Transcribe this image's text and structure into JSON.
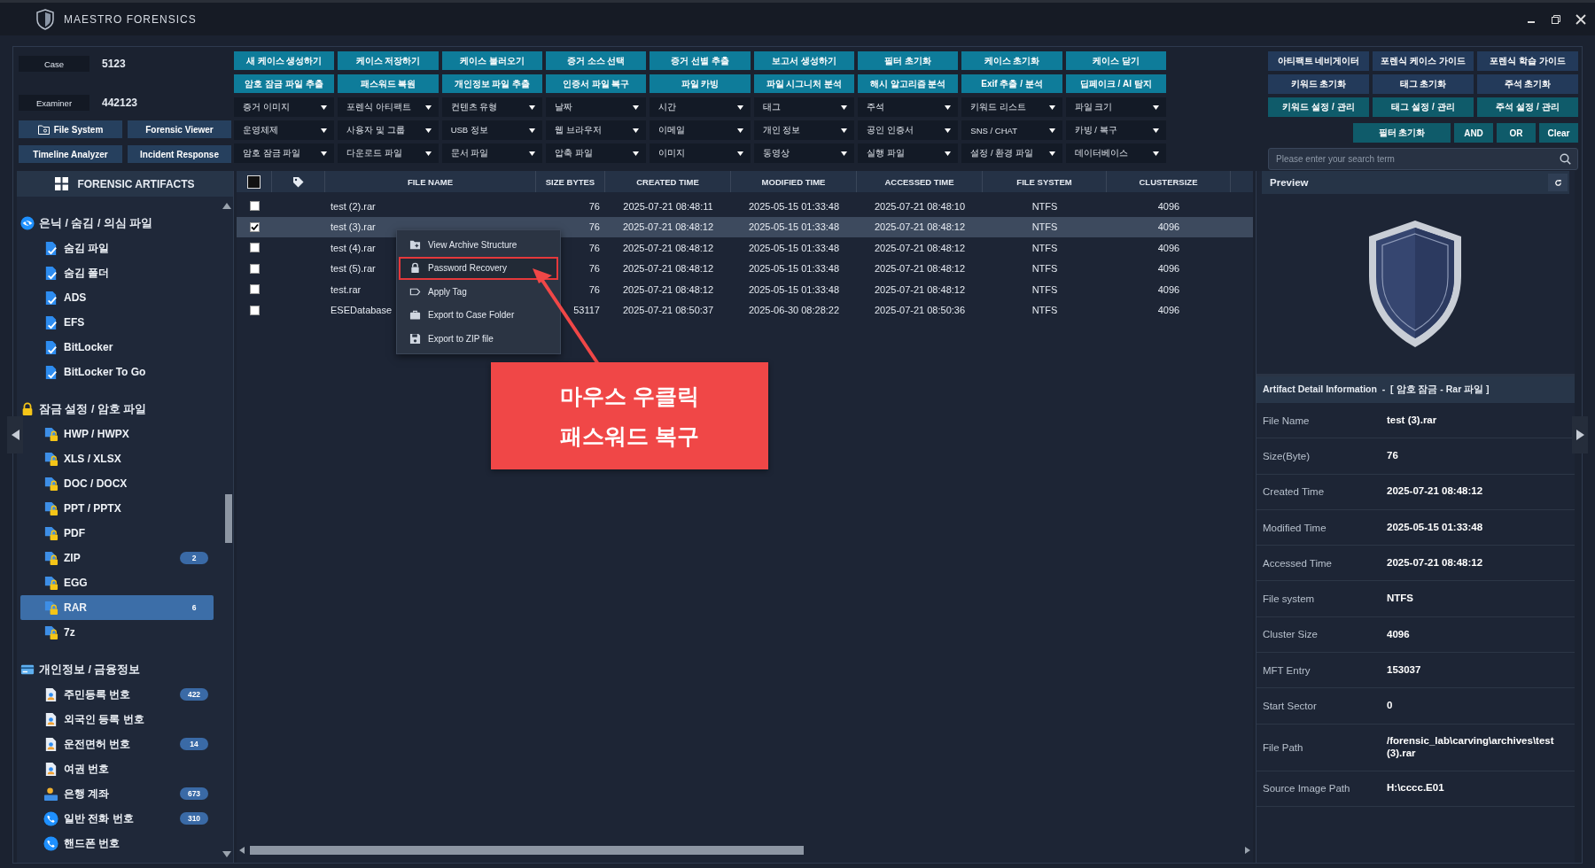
{
  "window": {
    "title": "MAESTRO FORENSICS"
  },
  "case_info": [
    {
      "label": "Case",
      "value": "5123"
    },
    {
      "label": "Examiner",
      "value": "442123"
    }
  ],
  "tool_buttons": [
    {
      "label": "File System",
      "kind": "folder"
    },
    {
      "label": "Forensic Viewer",
      "kind": "plain"
    },
    {
      "label": "Timeline Analyzer",
      "kind": "plain"
    },
    {
      "label": "Incident Response",
      "kind": "plain"
    }
  ],
  "action_rows": [
    [
      "새 케이스 생성하기",
      "케이스 저장하기",
      "케이스 불러오기",
      "증거 소스 선택",
      "증거 선별 추출",
      "보고서 생성하기",
      "필터 초기화",
      "케이스 초기화",
      "케이스 닫기"
    ],
    [
      "암호 잠금 파일 추출",
      "패스워드 복원",
      "개인정보 파일 추출",
      "인증서 파일 복구",
      "파일 카빙",
      "파일 시그니처 분석",
      "해시 알고리즘 분석",
      "Exif 추출 / 분석",
      "딥페이크 / AI 탐지"
    ]
  ],
  "filter_dropdowns": [
    [
      "증거 이미지",
      "포렌식 아티팩트",
      "컨텐츠 유형",
      "날짜",
      "시간",
      "태그",
      "주석",
      "키워드 리스트",
      "파일 크기"
    ],
    [
      "운영체제",
      "사용자 및 그룹",
      "USB 정보",
      "웹 브라우저",
      "이메일",
      "개인 정보",
      "공인 인증서",
      "SNS / CHAT",
      "카빙 / 복구"
    ],
    [
      "암호 잠금 파일",
      "다운로드 파일",
      "문서 파일",
      "압축 파일",
      "이미지",
      "동영상",
      "실행 파일",
      "설정 / 환경 파일",
      "데이터베이스"
    ]
  ],
  "quick_buttons": [
    [
      {
        "label": "아티팩트 네비게이터",
        "kind": "navy"
      },
      {
        "label": "포렌식 케이스 가이드",
        "kind": "navy"
      },
      {
        "label": "포렌식 학습 가이드",
        "kind": "navy"
      }
    ],
    [
      {
        "label": "키워드 초기화",
        "kind": "navy"
      },
      {
        "label": "태그 초기화",
        "kind": "navy"
      },
      {
        "label": "주석 초기화",
        "kind": "navy"
      }
    ],
    [
      {
        "label": "키워드 설정 / 관리",
        "kind": "teal"
      },
      {
        "label": "태그 설정 / 관리",
        "kind": "teal"
      },
      {
        "label": "주석 설정 / 관리",
        "kind": "teal"
      }
    ]
  ],
  "filter_bar": [
    "필터 초기화",
    "AND",
    "OR",
    "Clear"
  ],
  "search": {
    "placeholder": "Please enter your search term"
  },
  "sidebar": {
    "title": "FORENSIC ARTIFACTS",
    "groups": [
      {
        "label": "은닉 / 숨김 / 의심 파일",
        "kind": "eye",
        "children": [
          {
            "label": "숨김 파일",
            "kind": "file-check",
            "selected": false
          },
          {
            "label": "숨김 폴더",
            "kind": "file-check",
            "selected": false
          },
          {
            "label": "ADS",
            "kind": "file-check",
            "selected": false
          },
          {
            "label": "EFS",
            "kind": "file-check",
            "selected": false
          },
          {
            "label": "BitLocker",
            "kind": "file-check",
            "selected": false
          },
          {
            "label": "BitLocker To Go",
            "kind": "file-check",
            "selected": false
          }
        ]
      },
      {
        "label": "잠금 설정 / 암호 파일",
        "kind": "lock",
        "children": [
          {
            "label": "HWP / HWPX",
            "kind": "file-lock",
            "selected": false
          },
          {
            "label": "XLS / XLSX",
            "kind": "file-lock",
            "selected": false
          },
          {
            "label": "DOC / DOCX",
            "kind": "file-lock",
            "selected": false
          },
          {
            "label": "PPT / PPTX",
            "kind": "file-lock",
            "selected": false
          },
          {
            "label": "PDF",
            "kind": "file-lock",
            "selected": false
          },
          {
            "label": "ZIP",
            "kind": "file-lock",
            "badge": "2",
            "selected": false
          },
          {
            "label": "EGG",
            "kind": "file-lock",
            "selected": false
          },
          {
            "label": "RAR",
            "kind": "file-lock",
            "badge": "6",
            "selected": true
          },
          {
            "label": "7z",
            "kind": "file-lock",
            "selected": false
          }
        ]
      },
      {
        "label": "개인정보 / 금융정보",
        "kind": "card",
        "children": [
          {
            "label": "주민등록 번호",
            "kind": "id-doc",
            "badge": "422",
            "selected": false
          },
          {
            "label": "외국인 등록 번호",
            "kind": "id-doc",
            "selected": false
          },
          {
            "label": "운전면허 번호",
            "kind": "id-doc",
            "badge": "14",
            "selected": false
          },
          {
            "label": "여권 번호",
            "kind": "id-doc",
            "selected": false
          },
          {
            "label": "은행 계좌",
            "kind": "bank",
            "badge": "673",
            "selected": false
          },
          {
            "label": "일반 전화 번호",
            "kind": "phone",
            "badge": "310",
            "selected": false
          },
          {
            "label": "핸드폰 번호",
            "kind": "phone",
            "selected": false
          }
        ]
      }
    ]
  },
  "table": {
    "select_all": {
      "checked": false
    },
    "columns": [
      "FILE NAME",
      "SIZE BYTES",
      "CREATED TIME",
      "MODIFIED TIME",
      "ACCESSED TIME",
      "FILE SYSTEM",
      "CLUSTERSIZE"
    ],
    "rows": [
      {
        "checked": false,
        "selected": false,
        "cells": [
          "test (2).rar",
          "76",
          "2025-07-21 08:48:11",
          "2025-05-15 01:33:48",
          "2025-07-21 08:48:10",
          "NTFS",
          "4096"
        ]
      },
      {
        "checked": true,
        "selected": true,
        "cells": [
          "test (3).rar",
          "76",
          "2025-07-21 08:48:12",
          "2025-05-15 01:33:48",
          "2025-07-21 08:48:12",
          "NTFS",
          "4096"
        ]
      },
      {
        "checked": false,
        "selected": false,
        "cells": [
          "test (4).rar",
          "76",
          "2025-07-21 08:48:12",
          "2025-05-15 01:33:48",
          "2025-07-21 08:48:12",
          "NTFS",
          "4096"
        ]
      },
      {
        "checked": false,
        "selected": false,
        "cells": [
          "test (5).rar",
          "76",
          "2025-07-21 08:48:12",
          "2025-05-15 01:33:48",
          "2025-07-21 08:48:12",
          "NTFS",
          "4096"
        ]
      },
      {
        "checked": false,
        "selected": false,
        "cells": [
          "test.rar",
          "76",
          "2025-07-21 08:48:12",
          "2025-05-15 01:33:48",
          "2025-07-21 08:48:12",
          "NTFS",
          "4096"
        ]
      },
      {
        "checked": false,
        "selected": false,
        "cells": [
          "ESEDatabase",
          "53117",
          "2025-07-21 08:50:37",
          "2025-06-30 08:28:22",
          "2025-07-21 08:50:36",
          "NTFS",
          "4096"
        ]
      }
    ]
  },
  "context_menu": {
    "items": [
      {
        "label": "View Archive Structure",
        "kind": "folder-plus",
        "selected": false
      },
      {
        "label": "Password Recovery",
        "kind": "lock",
        "selected": true
      },
      {
        "label": "Apply Tag",
        "kind": "tag",
        "selected": false
      },
      {
        "label": "Export to Case Folder",
        "kind": "briefcase",
        "selected": false
      },
      {
        "label": "Export to ZIP file",
        "kind": "floppy",
        "selected": false
      }
    ]
  },
  "callout": {
    "lines": [
      "마우스 우클릭",
      "패스워드 복구"
    ]
  },
  "preview": {
    "title": "Preview"
  },
  "detail": {
    "title": "Artifact Detail Information  -  [ 암호 잠금 - Rar 파일 ]",
    "rows": [
      {
        "label": "File Name",
        "value": "test (3).rar"
      },
      {
        "label": "Size(Byte)",
        "value": "76"
      },
      {
        "label": "Created Time",
        "value": "2025-07-21 08:48:12"
      },
      {
        "label": "Modified Time",
        "value": "2025-05-15 01:33:48"
      },
      {
        "label": "Accessed Time",
        "value": "2025-07-21 08:48:12"
      },
      {
        "label": "File system",
        "value": "NTFS"
      },
      {
        "label": "Cluster Size",
        "value": "4096"
      },
      {
        "label": "MFT Entry",
        "value": "153037"
      },
      {
        "label": "Start Sector",
        "value": "0"
      },
      {
        "label": "File Path",
        "value": "/forensic_lab\\carving\\archives\\test (3).rar"
      },
      {
        "label": "Source Image Path",
        "value": "H:\\cccc.E01"
      }
    ]
  }
}
